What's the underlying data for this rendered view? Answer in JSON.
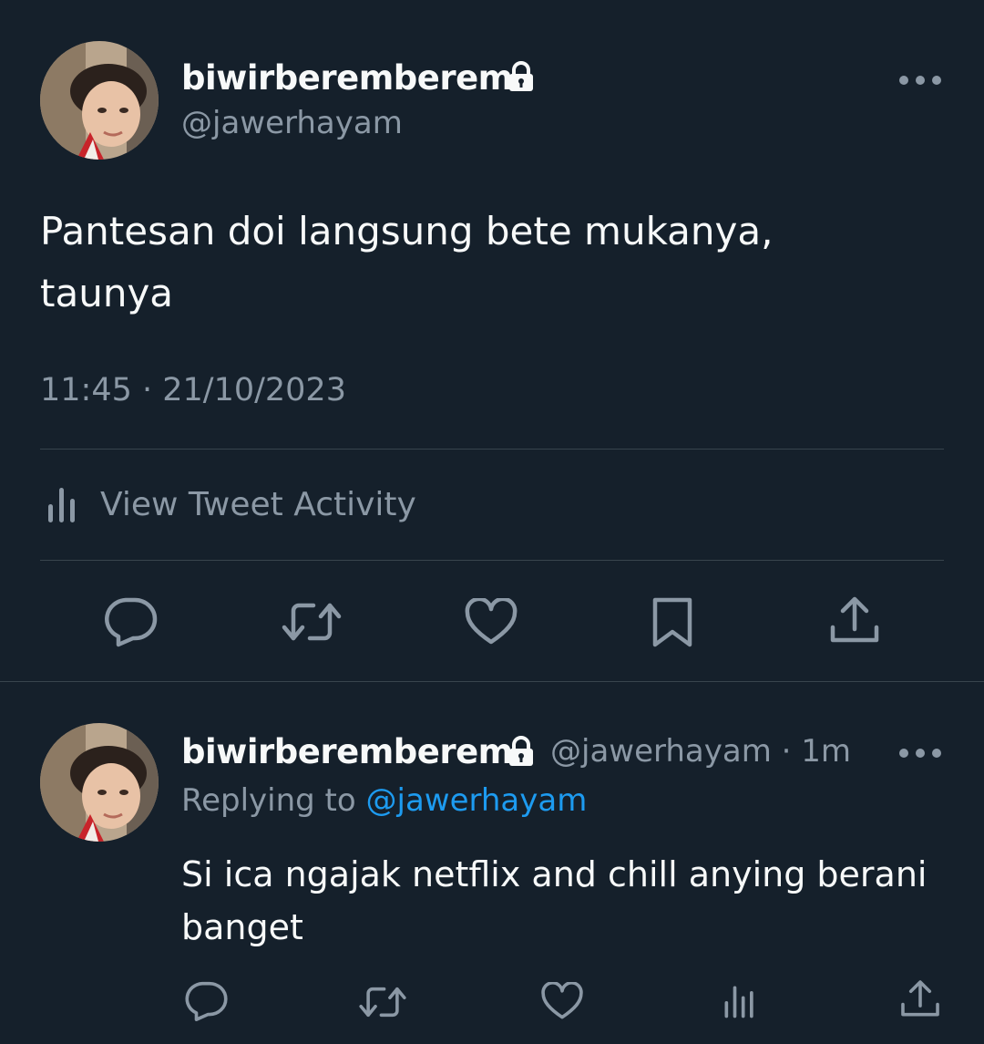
{
  "main_tweet": {
    "display_name": "biwirberemberem",
    "handle": "@jawerhayam",
    "text_line1": "Pantesan doi langsung bete mukanya,",
    "text_line2": "taunya",
    "timestamp": "11:45 · 21/10/2023",
    "activity_label": "View Tweet Activity"
  },
  "reply_tweet": {
    "display_name": "biwirberemberem",
    "meta": "@jawerhayam · 1m",
    "replying_prefix": "Replying to",
    "replying_mention": "@jawerhayam",
    "text_line1": "Si ica ngajak netflix and chill anying berani",
    "text_line2": "banget"
  },
  "colors": {
    "background": "#15202b",
    "primary_text": "#f7f9f9",
    "secondary_text": "#8b98a5",
    "accent": "#1d9bf0",
    "divider": "#38444d"
  },
  "icons": {
    "lock": "lock-icon",
    "more": "more-options-icon",
    "reply": "reply-icon",
    "retweet": "retweet-icon",
    "like": "heart-icon",
    "bookmark": "bookmark-icon",
    "share": "share-icon",
    "analytics": "analytics-icon"
  }
}
